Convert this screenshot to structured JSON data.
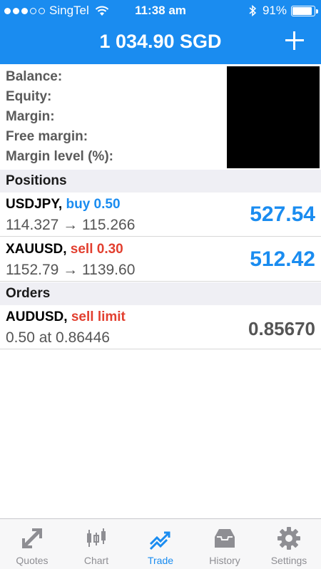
{
  "status_bar": {
    "carrier": "SingTel",
    "time": "11:38 am",
    "battery": "91%",
    "battery_level": 0.91
  },
  "nav": {
    "title": "1 034.90 SGD",
    "add_icon": "plus-icon"
  },
  "account": {
    "balance_label": "Balance:",
    "equity_label": "Equity:",
    "margin_label": "Margin:",
    "free_margin_label": "Free margin:",
    "margin_level_label": "Margin level (%):"
  },
  "positions": {
    "header": "Positions",
    "items": [
      {
        "symbol": "USDJPY,",
        "action": "buy 0.50",
        "prices": "114.327 → 115.266",
        "profit": "527.54"
      },
      {
        "symbol": "XAUUSD,",
        "action": "sell 0.30",
        "prices": "1152.79 → 1139.60",
        "profit": "512.42"
      }
    ]
  },
  "orders": {
    "header": "Orders",
    "items": [
      {
        "symbol": "AUDUSD,",
        "action": "sell limit",
        "detail": "0.50 at 0.86446",
        "price": "0.85670"
      }
    ]
  },
  "tabs": [
    {
      "label": "Quotes",
      "icon": "quotes-icon"
    },
    {
      "label": "Chart",
      "icon": "chart-icon"
    },
    {
      "label": "Trade",
      "icon": "trade-icon",
      "active": true
    },
    {
      "label": "History",
      "icon": "history-icon"
    },
    {
      "label": "Settings",
      "icon": "settings-icon"
    }
  ],
  "colors": {
    "accent": "#1a8cf0",
    "sell": "#e23f2f",
    "header_bg": "#1a8cf0",
    "section_bg": "#efeff4"
  }
}
